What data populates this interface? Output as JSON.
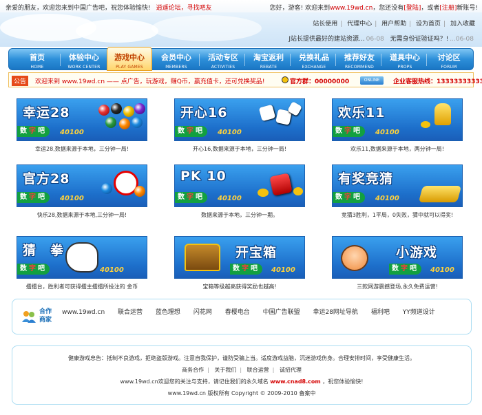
{
  "topbar": {
    "welcome": "亲爱的朋友，欢迎您来到中国广告吧，祝您体验愉快!",
    "forum_link": "逍遥论坛，寻找吧友",
    "hello": "您好，游客! 欢迎来到",
    "site": "www.19wd.cn",
    "not_logged": "，您还没有",
    "login": "[登陆]",
    "or": "，或者",
    "register": "[注册]",
    "new_account": "新账号!"
  },
  "quick_links": [
    "站长使用",
    "代理中心",
    "用户帮助",
    "设为首页",
    "加入收藏"
  ],
  "notice": {
    "item1": "J站长提供最好的建站资源...",
    "date1": "06-08",
    "item2": "无需身份证验证吗？!",
    "date2": "...06-08"
  },
  "nav": [
    {
      "cn": "首页",
      "en": "HOME"
    },
    {
      "cn": "体验中心",
      "en": "WORK CENTER"
    },
    {
      "cn": "游戏中心",
      "en": "PLAY GAMES"
    },
    {
      "cn": "会员中心",
      "en": "MEMBERS"
    },
    {
      "cn": "活动专区",
      "en": "ACTIVITIES"
    },
    {
      "cn": "淘宝返利",
      "en": "REBATE"
    },
    {
      "cn": "兑换礼品",
      "en": "EXCHANGE"
    },
    {
      "cn": "推荐好友",
      "en": "RECOMMEND"
    },
    {
      "cn": "道具中心",
      "en": "PROPS"
    },
    {
      "cn": "讨论区",
      "en": "FORUM"
    }
  ],
  "announcement": {
    "tag": "公告",
    "message": "欢迎来到 www.19wd.cn —— 点广告，玩游戏，赚Q币，赢充值卡，还可兑换奖品!",
    "qq_group": "官方群：00000000",
    "online_badge": "ONLINE",
    "hotline": "企业客服热线：13333333333"
  },
  "games": [
    {
      "title": "幸运28",
      "desc": "幸运28,数据来源于本地，三分钟一局!"
    },
    {
      "title": "开心16",
      "desc": "开心16,数据来源于本地，三分钟一局!"
    },
    {
      "title": "欢乐11",
      "desc": "欢乐11,数据来源于本地，两分钟一局!"
    },
    {
      "title": "官方28",
      "desc": "快乐28,数据来源于本地,三分钟一局!"
    },
    {
      "title": "PK 10",
      "desc": "数据来源于本地，三分钟一期。"
    },
    {
      "title": "有奖竞猜",
      "desc": "竞猜3胜利，1平局，0失败，猜中就可以得奖!"
    },
    {
      "title": "猜　拳",
      "desc": "擂擂台，胜利者可获得擂主擂擂所投注的 金币"
    },
    {
      "title": "开宝箱",
      "desc": "宝箱等级越高获得奖励也越高!"
    },
    {
      "title": "小游戏",
      "desc": "三款网游震撼登场,永久免费运营!"
    }
  ],
  "banner_common": {
    "label1": "数",
    "label2": "字",
    "label3": "吧",
    "number": "40100"
  },
  "partners": {
    "title_line1": "合作",
    "title_line2": "商家",
    "links": [
      "www.19wd.cn",
      "联合运营",
      "蓝色理想",
      "闪花网",
      "春樱电台",
      "中国广告联盟",
      "幸运28网址导航",
      "福利吧",
      "YY频道设计"
    ]
  },
  "footer": {
    "line1": "健康游戏忠告：抵制不良游戏，拒绝盗版游戏。注意自我保护，谨防受骗上当。适度游戏益脑，沉迷游戏伤身。合理安排时间，享受健康生活。",
    "links": [
      "商务合作",
      "关于我们",
      "联合运营",
      "诚招代理"
    ],
    "line3_prefix": "www.19wd.cn欢迎您的关注与支持，请记住我们的永久域名",
    "domain": "www.cnad8.com",
    "line3_suffix": "，祝您体验愉快!",
    "copyright": "www.19wd.cn 版权所有 Copyright © 2009-2010 备案中"
  }
}
